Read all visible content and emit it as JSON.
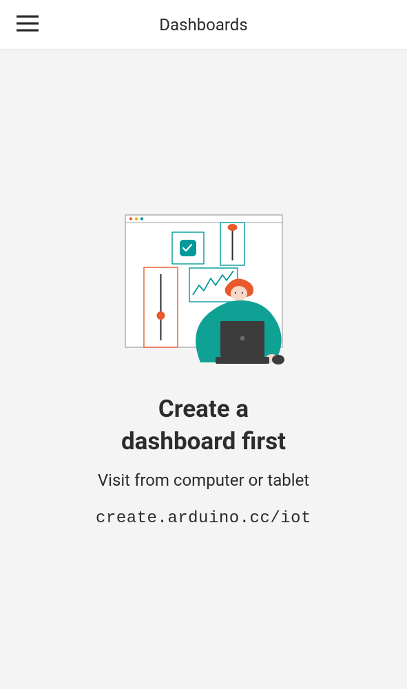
{
  "header": {
    "title": "Dashboards",
    "menu_icon": "hamburger-menu-icon"
  },
  "empty_state": {
    "heading_line1": "Create a",
    "heading_line2": "dashboard first",
    "subtext": "Visit from computer or tablet",
    "url": "create.arduino.cc/iot",
    "illustration": "dashboard-illustration"
  },
  "colors": {
    "accent_teal": "#009999",
    "accent_orange": "#e85a2c",
    "text": "#2c2c2c",
    "bg": "#f4f4f4"
  }
}
